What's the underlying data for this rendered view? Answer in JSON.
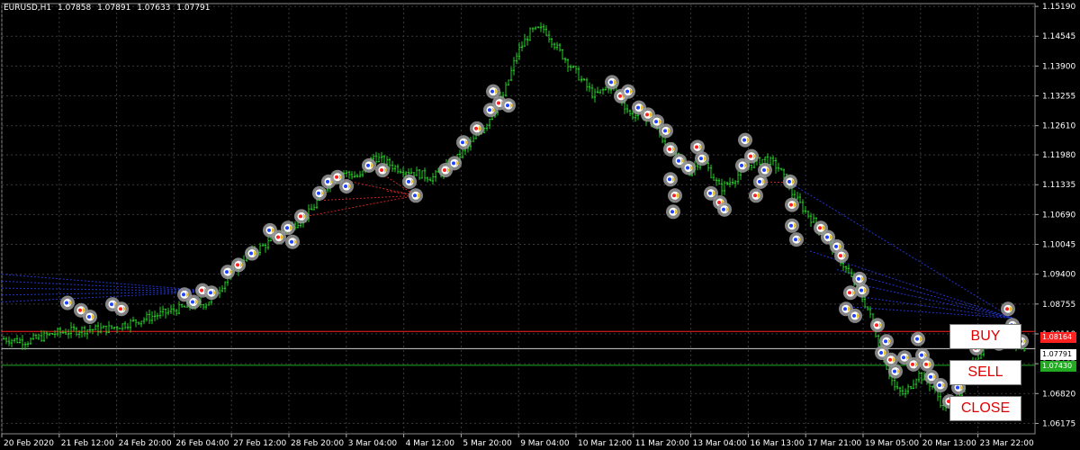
{
  "header": {
    "symbol": "EURUSD,H1",
    "open": "1.07858",
    "high": "1.07891",
    "low": "1.07633",
    "close": "1.07791"
  },
  "buttons": {
    "buy": "BUY",
    "sell": "SELL",
    "close": "CLOSE"
  },
  "price_labels": {
    "red": "1.08164",
    "current": "1.07791",
    "green": "1.07430"
  },
  "colors": {
    "background": "#000000",
    "grid": "#3a3a3a",
    "candle": "#22cc22",
    "buy_level": "#ff2020",
    "sell_level": "#22aa22",
    "marker_ring": "#9a9a9a"
  },
  "chart_data": {
    "type": "candlestick",
    "y_ticks": [
      "1.15190",
      "1.14545",
      "1.13900",
      "1.13255",
      "1.12610",
      "1.11980",
      "1.11335",
      "1.10690",
      "1.10045",
      "1.09400",
      "1.08755",
      "1.08110",
      "1.07465",
      "1.06820",
      "1.06175"
    ],
    "x_ticks": [
      "20 Feb 2020",
      "21 Feb 12:00",
      "24 Feb 20:00",
      "26 Feb 04:00",
      "27 Feb 12:00",
      "28 Feb 20:00",
      "3 Mar 04:00",
      "4 Mar 12:00",
      "5 Mar 20:00",
      "9 Mar 04:00",
      "10 Mar 12:00",
      "11 Mar 20:00",
      "13 Mar 04:00",
      "16 Mar 13:00",
      "17 Mar 21:00",
      "19 Mar 05:00",
      "20 Mar 13:00",
      "23 Mar 22:00"
    ],
    "ylim": [
      1.0595,
      1.1525
    ],
    "grid": true,
    "close_path": [
      [
        0,
        1.0801
      ],
      [
        30,
        1.0795
      ],
      [
        60,
        1.0812
      ],
      [
        90,
        1.082
      ],
      [
        120,
        1.0822
      ],
      [
        150,
        1.0838
      ],
      [
        180,
        1.0855
      ],
      [
        210,
        1.0871
      ],
      [
        230,
        1.0878
      ],
      [
        250,
        1.0925
      ],
      [
        270,
        1.0975
      ],
      [
        300,
        1.101
      ],
      [
        320,
        1.1038
      ],
      [
        345,
        1.1075
      ],
      [
        365,
        1.114
      ],
      [
        380,
        1.116
      ],
      [
        400,
        1.115
      ],
      [
        415,
        1.1195
      ],
      [
        440,
        1.117
      ],
      [
        460,
        1.116
      ],
      [
        480,
        1.1148
      ],
      [
        500,
        1.1175
      ],
      [
        520,
        1.1215
      ],
      [
        540,
        1.1265
      ],
      [
        560,
        1.133
      ],
      [
        575,
        1.142
      ],
      [
        590,
        1.1465
      ],
      [
        605,
        1.147
      ],
      [
        620,
        1.1425
      ],
      [
        640,
        1.1375
      ],
      [
        660,
        1.1325
      ],
      [
        680,
        1.135
      ],
      [
        700,
        1.1285
      ],
      [
        720,
        1.128
      ],
      [
        735,
        1.1235
      ],
      [
        750,
        1.1195
      ],
      [
        765,
        1.116
      ],
      [
        780,
        1.119
      ],
      [
        800,
        1.1125
      ],
      [
        815,
        1.1145
      ],
      [
        830,
        1.1175
      ],
      [
        850,
        1.119
      ],
      [
        865,
        1.117
      ],
      [
        880,
        1.1115
      ],
      [
        895,
        1.1075
      ],
      [
        910,
        1.104
      ],
      [
        925,
        1.1
      ],
      [
        940,
        1.095
      ],
      [
        955,
        1.09
      ],
      [
        965,
        1.086
      ],
      [
        975,
        1.08
      ],
      [
        985,
        1.074
      ],
      [
        995,
        1.069
      ],
      [
        1005,
        1.068
      ],
      [
        1020,
        1.0725
      ],
      [
        1035,
        1.07
      ],
      [
        1045,
        1.0665
      ],
      [
        1055,
        1.065
      ],
      [
        1070,
        1.07
      ],
      [
        1085,
        1.076
      ],
      [
        1100,
        1.08
      ],
      [
        1115,
        1.0815
      ],
      [
        1130,
        1.079
      ],
      [
        1140,
        1.0779
      ]
    ],
    "levels": [
      {
        "name": "buy",
        "price": 1.08164,
        "color": "#ff2020"
      },
      {
        "name": "current",
        "price": 1.07791,
        "color": "#cfcfcf"
      },
      {
        "name": "sell",
        "price": 1.0743,
        "color": "#22aa22"
      }
    ],
    "markers": [
      [
        75,
        1.0878
      ],
      [
        90,
        1.0862
      ],
      [
        100,
        1.0848
      ],
      [
        125,
        1.0875
      ],
      [
        135,
        1.0865
      ],
      [
        205,
        1.0896
      ],
      [
        215,
        1.088
      ],
      [
        225,
        1.0905
      ],
      [
        235,
        1.09
      ],
      [
        253,
        1.0945
      ],
      [
        265,
        1.096
      ],
      [
        280,
        1.0985
      ],
      [
        300,
        1.1035
      ],
      [
        310,
        1.102
      ],
      [
        320,
        1.104
      ],
      [
        325,
        1.101
      ],
      [
        335,
        1.1065
      ],
      [
        355,
        1.1115
      ],
      [
        365,
        1.114
      ],
      [
        375,
        1.115
      ],
      [
        385,
        1.113
      ],
      [
        410,
        1.1175
      ],
      [
        425,
        1.1165
      ],
      [
        455,
        1.114
      ],
      [
        462,
        1.111
      ],
      [
        495,
        1.1165
      ],
      [
        505,
        1.118
      ],
      [
        515,
        1.1225
      ],
      [
        530,
        1.1255
      ],
      [
        548,
        1.1335
      ],
      [
        545,
        1.1295
      ],
      [
        555,
        1.131
      ],
      [
        565,
        1.1305
      ],
      [
        680,
        1.1355
      ],
      [
        690,
        1.1325
      ],
      [
        698,
        1.1335
      ],
      [
        710,
        1.13
      ],
      [
        720,
        1.1285
      ],
      [
        730,
        1.127
      ],
      [
        740,
        1.125
      ],
      [
        745,
        1.121
      ],
      [
        755,
        1.1185
      ],
      [
        745,
        1.1145
      ],
      [
        750,
        1.111
      ],
      [
        748,
        1.1075
      ],
      [
        765,
        1.117
      ],
      [
        775,
        1.1215
      ],
      [
        780,
        1.119
      ],
      [
        790,
        1.1115
      ],
      [
        800,
        1.1095
      ],
      [
        805,
        1.108
      ],
      [
        828,
        1.123
      ],
      [
        835,
        1.1195
      ],
      [
        825,
        1.1175
      ],
      [
        845,
        1.114
      ],
      [
        840,
        1.111
      ],
      [
        850,
        1.1165
      ],
      [
        878,
        1.114
      ],
      [
        880,
        1.109
      ],
      [
        880,
        1.1045
      ],
      [
        885,
        1.1015
      ],
      [
        912,
        1.104
      ],
      [
        920,
        1.102
      ],
      [
        930,
        1.1
      ],
      [
        935,
        1.098
      ],
      [
        955,
        1.093
      ],
      [
        958,
        1.0905
      ],
      [
        945,
        1.09
      ],
      [
        940,
        1.0865
      ],
      [
        950,
        1.085
      ],
      [
        975,
        1.083
      ],
      [
        985,
        1.0795
      ],
      [
        980,
        1.077
      ],
      [
        990,
        1.0755
      ],
      [
        995,
        1.073
      ],
      [
        1005,
        1.076
      ],
      [
        1015,
        1.0745
      ],
      [
        1020,
        1.08
      ],
      [
        1025,
        1.0765
      ],
      [
        1030,
        1.0745
      ],
      [
        1035,
        1.0718
      ],
      [
        1045,
        1.07
      ],
      [
        1055,
        1.0665
      ],
      [
        1065,
        1.0695
      ],
      [
        1075,
        1.072
      ],
      [
        1085,
        1.078
      ],
      [
        1100,
        1.08
      ],
      [
        1110,
        1.079
      ],
      [
        1120,
        1.0865
      ],
      [
        1125,
        1.083
      ],
      [
        1135,
        1.0795
      ]
    ]
  }
}
